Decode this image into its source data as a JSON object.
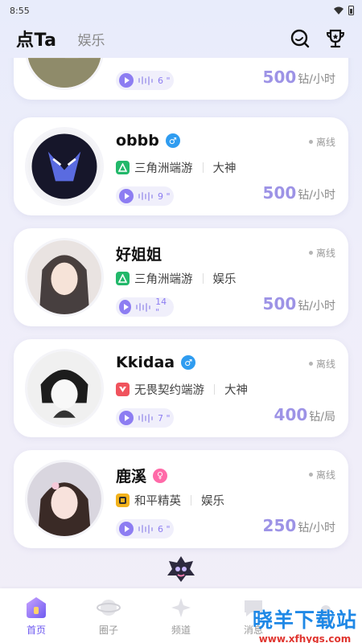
{
  "status_bar": {
    "time": "8:55"
  },
  "header": {
    "active_tab": "点Ta",
    "inactive_tab": "娱乐",
    "search_icon": "search-icon",
    "trophy_icon": "trophy-icon"
  },
  "cards": [
    {
      "name": "",
      "status": "",
      "game": "",
      "category": "",
      "voice_duration": "6 \"",
      "price": "500",
      "unit": "钻/小时",
      "gender": ""
    },
    {
      "name": "obbb",
      "status": "离线",
      "game": "三角洲端游",
      "category": "大神",
      "voice_duration": "9 \"",
      "price": "500",
      "unit": "钻/小时",
      "gender": "male"
    },
    {
      "name": "好姐姐",
      "status": "离线",
      "game": "三角洲端游",
      "category": "娱乐",
      "voice_duration": "14 \"",
      "price": "500",
      "unit": "钻/小时",
      "gender": ""
    },
    {
      "name": "Kkidaa",
      "status": "离线",
      "game": "无畏契约端游",
      "category": "大神",
      "voice_duration": "7 \"",
      "price": "400",
      "unit": "钻/局",
      "gender": "male"
    },
    {
      "name": "鹿溪",
      "status": "离线",
      "game": "和平精英",
      "category": "娱乐",
      "voice_duration": "6 \"",
      "price": "250",
      "unit": "钻/小时",
      "gender": "female"
    }
  ],
  "nav": {
    "home": "首页",
    "circle": "圈子",
    "channel": "频道",
    "messages": "消息",
    "mine": ""
  },
  "watermark": {
    "title": "晓羊下载站",
    "url": "www.xfhygs.com"
  },
  "colors": {
    "accent": "#6f5bf0",
    "price": "#9d93e6",
    "delta_game": "#22b86a",
    "valorant_game": "#f0535d"
  }
}
